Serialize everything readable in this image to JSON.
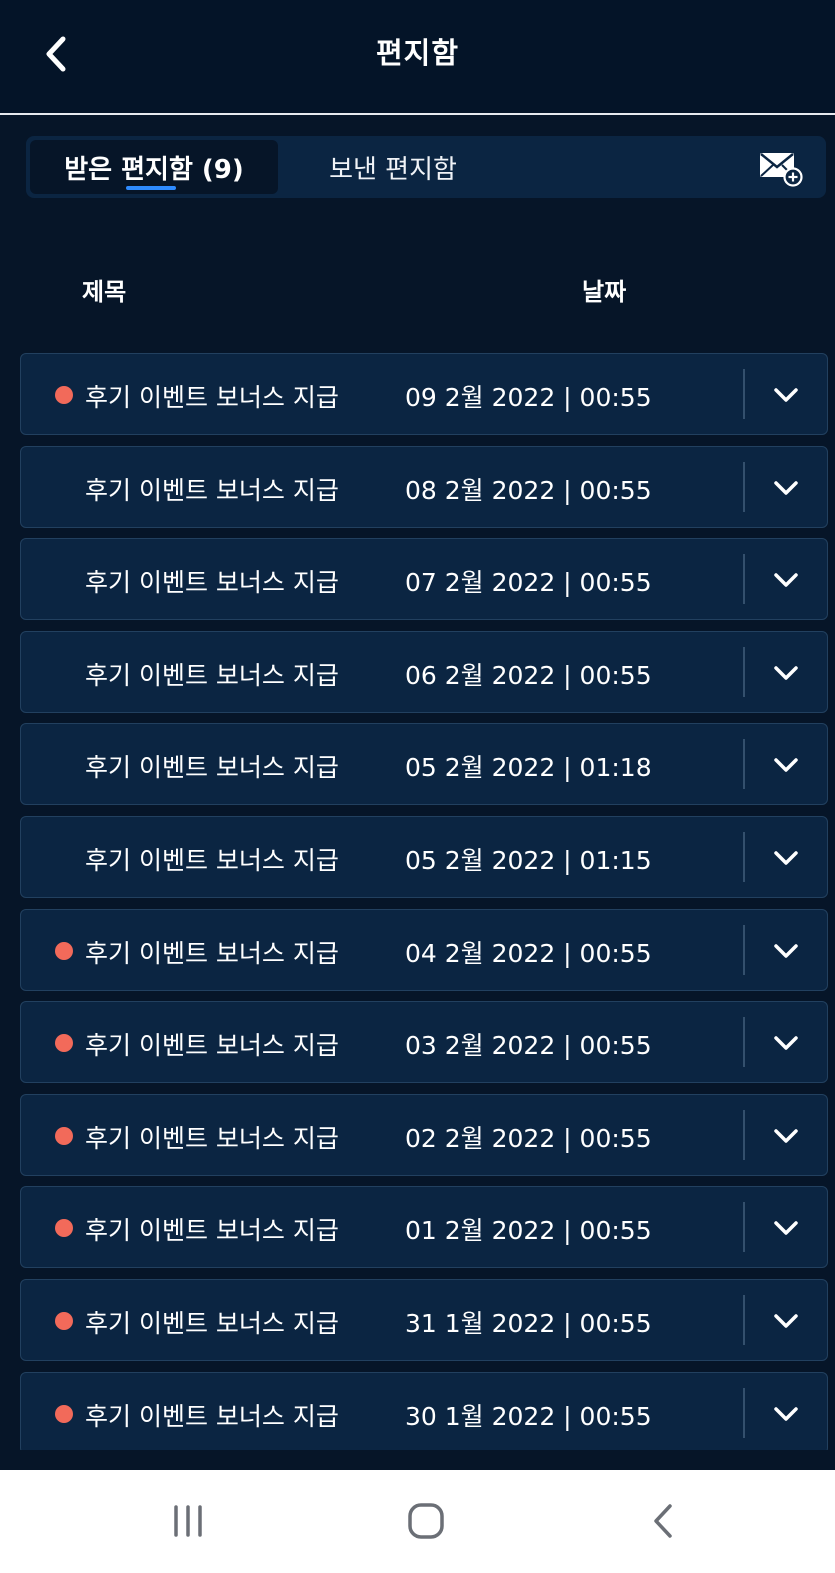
{
  "header": {
    "title": "편지함",
    "back_icon": "chevron-left-icon"
  },
  "tabs": {
    "inbox_label": "받은 편지함 (9)",
    "sent_label": "보낸 편지함",
    "active": "inbox",
    "compose_icon": "compose-mail-icon"
  },
  "columns": {
    "subject": "제목",
    "date": "날짜"
  },
  "colors": {
    "background": "#061528",
    "row": "#0b2542",
    "accent": "#2e8bff",
    "unread": "#f26a5a"
  },
  "messages": [
    {
      "subject": "후기 이벤트 보너스 지급",
      "date": "09 2월 2022 | 00:55",
      "unread": true
    },
    {
      "subject": "후기 이벤트 보너스 지급",
      "date": "08 2월 2022 | 00:55",
      "unread": false
    },
    {
      "subject": "후기 이벤트 보너스 지급",
      "date": "07 2월 2022 | 00:55",
      "unread": false
    },
    {
      "subject": "후기 이벤트 보너스 지급",
      "date": "06 2월 2022 | 00:55",
      "unread": false
    },
    {
      "subject": "후기 이벤트 보너스 지급",
      "date": "05 2월 2022 | 01:18",
      "unread": false
    },
    {
      "subject": "후기 이벤트 보너스 지급",
      "date": "05 2월 2022 | 01:15",
      "unread": false
    },
    {
      "subject": "후기 이벤트 보너스 지급",
      "date": "04 2월 2022 | 00:55",
      "unread": true
    },
    {
      "subject": "후기 이벤트 보너스 지급",
      "date": "03 2월 2022 | 00:55",
      "unread": true
    },
    {
      "subject": "후기 이벤트 보너스 지급",
      "date": "02 2월 2022 | 00:55",
      "unread": true
    },
    {
      "subject": "후기 이벤트 보너스 지급",
      "date": "01 2월 2022 | 00:55",
      "unread": true
    },
    {
      "subject": "후기 이벤트 보너스 지급",
      "date": "31 1월 2022 | 00:55",
      "unread": true
    },
    {
      "subject": "후기 이벤트 보너스 지급",
      "date": "30 1월 2022 | 00:55",
      "unread": true
    }
  ],
  "navbar": {
    "recent_icon": "recent-apps-icon",
    "home_icon": "home-icon",
    "back_icon": "back-icon"
  }
}
